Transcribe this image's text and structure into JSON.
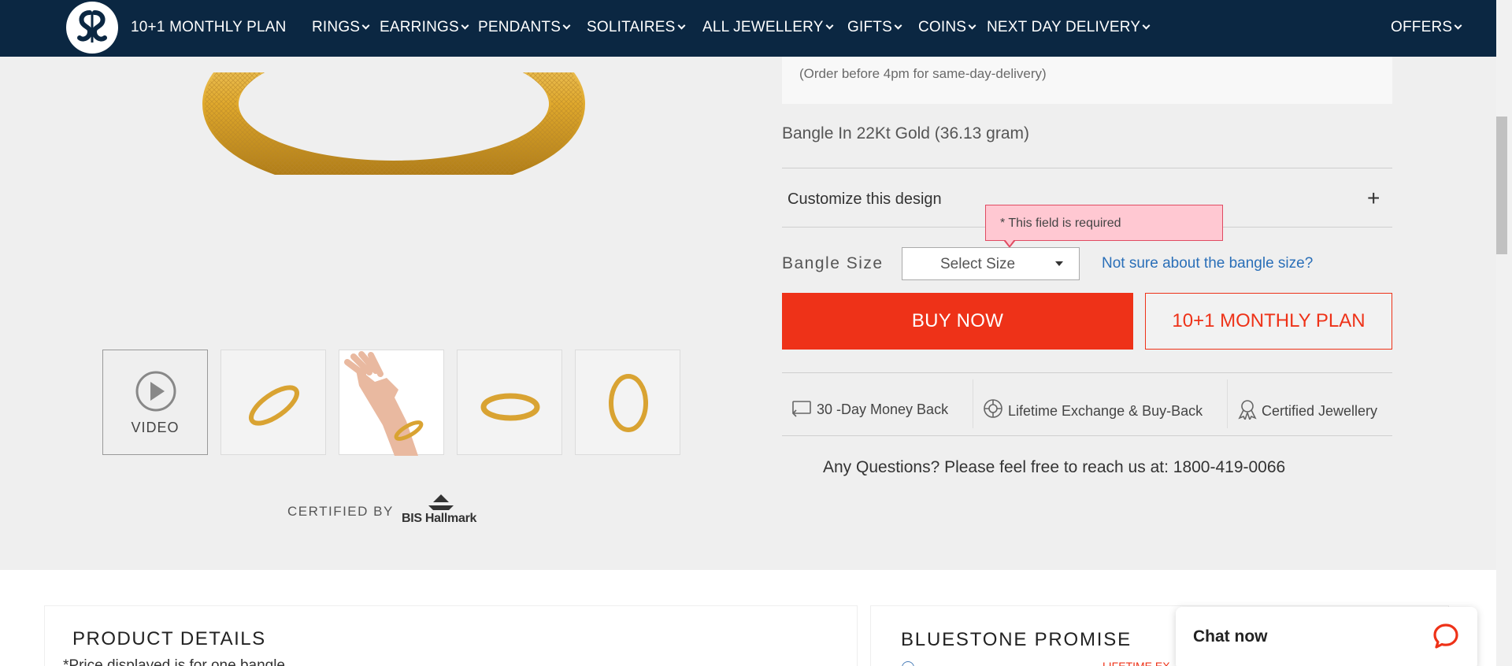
{
  "nav": {
    "items": [
      {
        "label": "10+1 MONTHLY PLAN",
        "has_dropdown": false
      },
      {
        "label": "RINGS",
        "has_dropdown": true
      },
      {
        "label": "EARRINGS",
        "has_dropdown": true
      },
      {
        "label": "PENDANTS",
        "has_dropdown": true
      },
      {
        "label": "SOLITAIRES",
        "has_dropdown": true
      },
      {
        "label": "ALL JEWELLERY",
        "has_dropdown": true
      },
      {
        "label": "GIFTS",
        "has_dropdown": true
      },
      {
        "label": "COINS",
        "has_dropdown": true
      },
      {
        "label": "NEXT DAY DELIVERY",
        "has_dropdown": true
      },
      {
        "label": "OFFERS",
        "has_dropdown": true
      }
    ]
  },
  "gallery": {
    "video_label": "VIDEO",
    "thumbnails": [
      "video",
      "bangle-angle",
      "bangle-on-wrist",
      "bangle-flat",
      "bangle-side"
    ]
  },
  "certification": {
    "label": "CERTIFIED BY",
    "badge_text": "BIS Hallmark"
  },
  "delivery": {
    "note": "(Order before 4pm for same-day-delivery)"
  },
  "product": {
    "title": "Bangle In 22Kt Gold (36.13 gram)"
  },
  "customize": {
    "label": "Customize this design",
    "expand_icon": "+"
  },
  "validation": {
    "message": "* This field is required"
  },
  "size": {
    "label": "Bangle Size",
    "selected": "Select Size",
    "help_link": "Not sure about the bangle size?"
  },
  "actions": {
    "buy_now": "BUY NOW",
    "monthly_plan": "10+1 MONTHLY PLAN"
  },
  "features": [
    {
      "icon": "money-back-icon",
      "label": "30 -Day Money Back"
    },
    {
      "icon": "exchange-icon",
      "label": "Lifetime Exchange & Buy-Back"
    },
    {
      "icon": "certified-icon",
      "label": "Certified Jewellery"
    }
  ],
  "contact": {
    "text": "Any Questions? Please feel free to reach us at: ",
    "phone": "1800-419-0066"
  },
  "product_details": {
    "title": "PRODUCT DETAILS",
    "note": "*Price displayed is for one bangle"
  },
  "promise": {
    "title": "BLUESTONE PROMISE",
    "sub": "LIFETIME EX"
  },
  "chat": {
    "label": "Chat now"
  },
  "colors": {
    "nav_bg": "#0b2742",
    "accent": "#ee3218",
    "link": "#2a6fb8",
    "tooltip_bg": "#ffc8d2"
  }
}
